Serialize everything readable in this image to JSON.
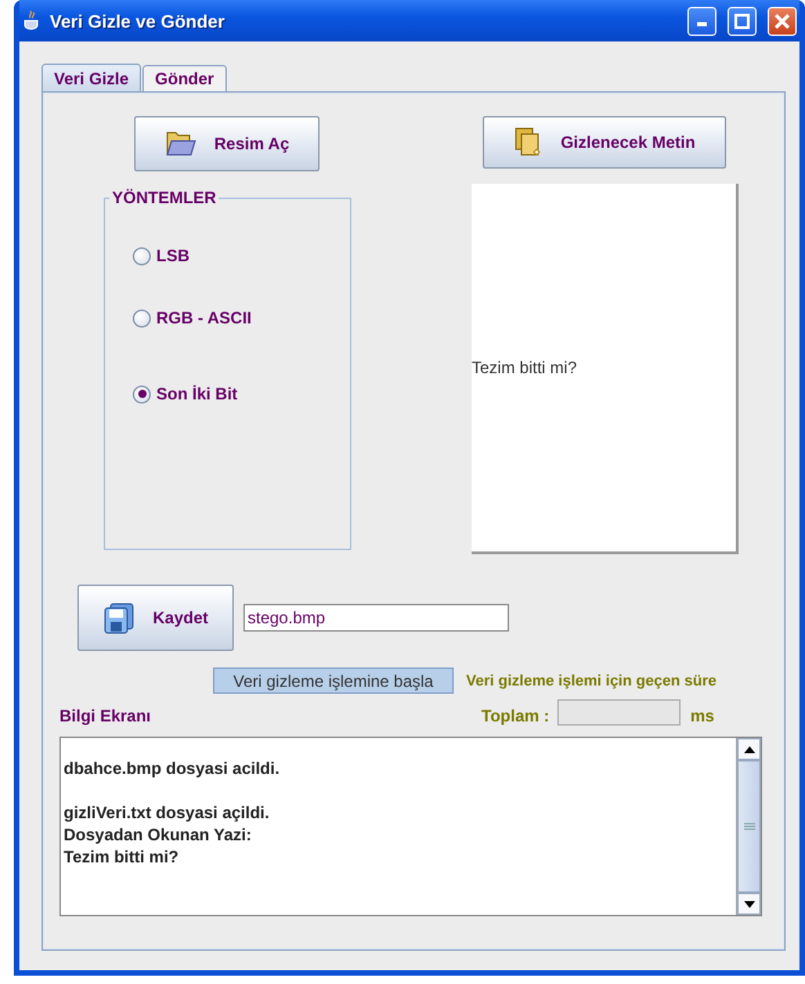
{
  "window": {
    "title": "Veri Gizle ve Gönder"
  },
  "tabs": [
    {
      "label": "Veri Gizle",
      "selected": true
    },
    {
      "label": "Gönder",
      "selected": false
    }
  ],
  "open_image_button": {
    "label": "Resim Aç"
  },
  "hidden_text_button": {
    "label": "Gizlenecek Metin"
  },
  "methods": {
    "title": "YÖNTEMLER",
    "options": [
      {
        "label": "LSB",
        "selected": false
      },
      {
        "label": "RGB - ASCII",
        "selected": false
      },
      {
        "label": "Son İki Bit",
        "selected": true
      }
    ]
  },
  "hidden_text": {
    "value": "Tezim bitti mi?"
  },
  "save_button": {
    "label": "Kaydet"
  },
  "output_file": {
    "value": "stego.bmp"
  },
  "start_button": {
    "label": "Veri gizleme işlemine başla"
  },
  "duration": {
    "label": "Veri gizleme işlemi için geçen süre",
    "total_label": "Toplam :",
    "unit": "ms"
  },
  "info": {
    "title": "Bilgi Ekranı",
    "paragraphs": [
      [
        "dbahce.bmp dosyasi acildi."
      ],
      [
        "gizliVeri.txt dosyasi açildi.",
        "Dosyadan Okunan Yazi:",
        "Tezim bitti mi?"
      ]
    ]
  }
}
